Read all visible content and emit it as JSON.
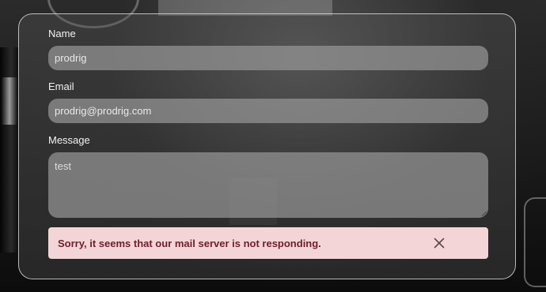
{
  "form": {
    "name": {
      "label": "Name",
      "value": "prodrig"
    },
    "email": {
      "label": "Email",
      "value": "prodrig@prodrig.com"
    },
    "message": {
      "label": "Message",
      "value": "test"
    }
  },
  "alert": {
    "text": "Sorry, it seems that our mail server is not responding.",
    "background": "#f3d5d8",
    "text_color": "#6d1f29",
    "close_icon": "close-icon"
  }
}
